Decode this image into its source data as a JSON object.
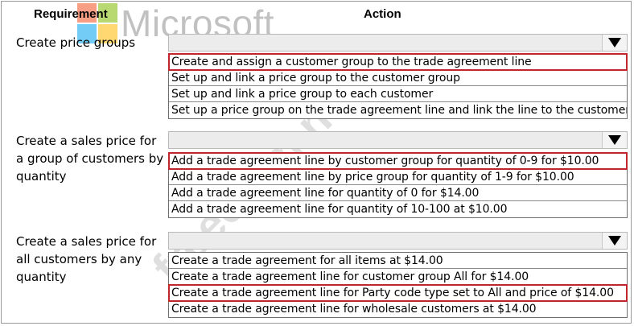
{
  "headers": {
    "requirement": "Requirement",
    "action": "Action"
  },
  "watermark": {
    "brand": "Microsoft",
    "site": "freecram.net"
  },
  "colors": {
    "highlight": "#c0272d",
    "ms_red": "#f25022",
    "ms_green": "#7fba00",
    "ms_blue": "#00a4ef",
    "ms_yellow": "#ffb900"
  },
  "rows": [
    {
      "requirement": "Create price groups",
      "dropdown_icon": "triangle-down-icon",
      "options": [
        {
          "text": "Create and assign a customer group to the trade agreement line",
          "selected": true
        },
        {
          "text": "Set up and link a price group to the customer group",
          "selected": false
        },
        {
          "text": "Set up and link a price group to each customer",
          "selected": false
        },
        {
          "text": "Set up a price group on the trade agreement line and link the line to the customer",
          "selected": false
        }
      ]
    },
    {
      "requirement": "Create a sales price for a group of customers by quantity",
      "dropdown_icon": "triangle-down-icon",
      "options": [
        {
          "text": "Add a trade agreement line by customer group for quantity of 0-9 for $10.00",
          "selected": true
        },
        {
          "text": "Add a trade agreement line by price group for quantity of 1-9 for $10.00",
          "selected": false
        },
        {
          "text": "Add a trade agreement line for quantity of 0 for $14.00",
          "selected": false
        },
        {
          "text": "Add a trade agreement line for quantity of 10-100 at $10.00",
          "selected": false
        }
      ]
    },
    {
      "requirement": "Create a sales price for all customers by any quantity",
      "dropdown_icon": "triangle-down-icon",
      "options": [
        {
          "text": "Create a trade agreement for all items at $14.00",
          "selected": false
        },
        {
          "text": "Create a trade agreement line for customer group All for $14.00",
          "selected": false
        },
        {
          "text": "Create a trade agreement line for Party code type set to All and price of $14.00",
          "selected": true
        },
        {
          "text": "Create a trade agreement line for wholesale customers at $14.00",
          "selected": false
        }
      ]
    }
  ]
}
